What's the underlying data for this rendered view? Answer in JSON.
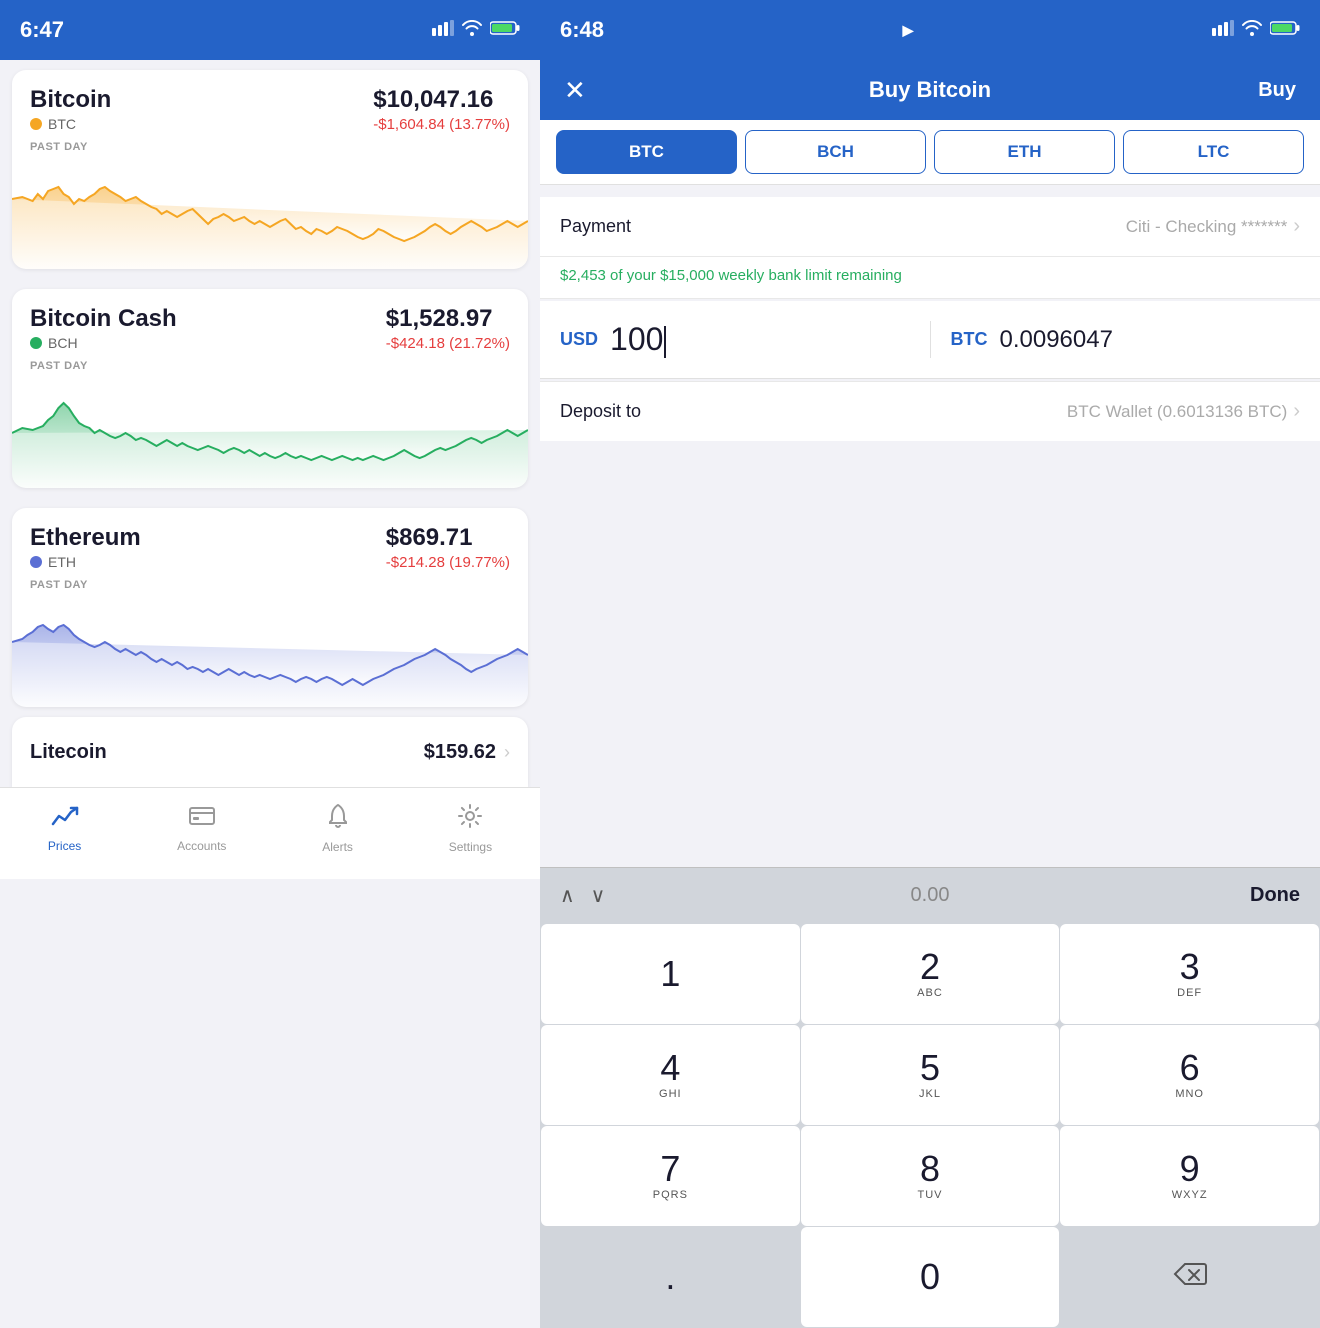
{
  "left": {
    "statusBar": {
      "time": "6:47",
      "locationIcon": "▶",
      "signalIcon": "▐▌▌",
      "wifiIcon": "wifi",
      "batteryIcon": "battery"
    },
    "cryptos": [
      {
        "name": "Bitcoin",
        "ticker": "BTC",
        "dotColor": "#f5a623",
        "price": "$10,047.16",
        "change": "-$1,604.84 (13.77%)",
        "chartColor": "#f5a623",
        "chartFillColor": "rgba(245,166,35,0.15)"
      },
      {
        "name": "Bitcoin Cash",
        "ticker": "BCH",
        "dotColor": "#27ae60",
        "price": "$1,528.97",
        "change": "-$424.18 (21.72%)",
        "chartColor": "#27ae60",
        "chartFillColor": "rgba(39,174,96,0.15)"
      },
      {
        "name": "Ethereum",
        "ticker": "ETH",
        "dotColor": "#5b6fd4",
        "price": "$869.71",
        "change": "-$214.28 (19.77%)",
        "chartColor": "#5b6fd4",
        "chartFillColor": "rgba(91,111,212,0.15)"
      }
    ],
    "litecoin": {
      "name": "Litecoin",
      "price": "$159.62"
    },
    "pastDayLabel": "PAST DAY",
    "nav": {
      "items": [
        {
          "label": "Prices",
          "icon": "chart",
          "active": true
        },
        {
          "label": "Accounts",
          "icon": "accounts",
          "active": false
        },
        {
          "label": "Alerts",
          "icon": "bell",
          "active": false
        },
        {
          "label": "Settings",
          "icon": "gear",
          "active": false
        }
      ]
    }
  },
  "right": {
    "statusBar": {
      "time": "6:48"
    },
    "header": {
      "closeLabel": "✕",
      "title": "Buy Bitcoin",
      "actionLabel": "Buy"
    },
    "tabs": [
      {
        "label": "BTC",
        "active": true
      },
      {
        "label": "BCH",
        "active": false
      },
      {
        "label": "ETH",
        "active": false
      },
      {
        "label": "LTC",
        "active": false
      }
    ],
    "payment": {
      "label": "Payment",
      "value": "Citi - Checking *******"
    },
    "limitNotice": "$2,453 of your $15,000 weekly bank limit remaining",
    "amountUSD": {
      "currency": "USD",
      "value": "100"
    },
    "amountBTC": {
      "currency": "BTC",
      "value": "0.0096047"
    },
    "deposit": {
      "label": "Deposit to",
      "value": "BTC Wallet (0.6013136 BTC)"
    },
    "keyboard": {
      "toolbarValue": "0.00",
      "toolbarDone": "Done",
      "keys": [
        {
          "main": "1",
          "sub": ""
        },
        {
          "main": "2",
          "sub": "ABC"
        },
        {
          "main": "3",
          "sub": "DEF"
        },
        {
          "main": "4",
          "sub": "GHI"
        },
        {
          "main": "5",
          "sub": "JKL"
        },
        {
          "main": "6",
          "sub": "MNO"
        },
        {
          "main": "7",
          "sub": "PQRS"
        },
        {
          "main": "8",
          "sub": "TUV"
        },
        {
          "main": "9",
          "sub": "WXYZ"
        },
        {
          "main": ".",
          "sub": ""
        },
        {
          "main": "0",
          "sub": ""
        },
        {
          "main": "⌫",
          "sub": ""
        }
      ]
    }
  }
}
